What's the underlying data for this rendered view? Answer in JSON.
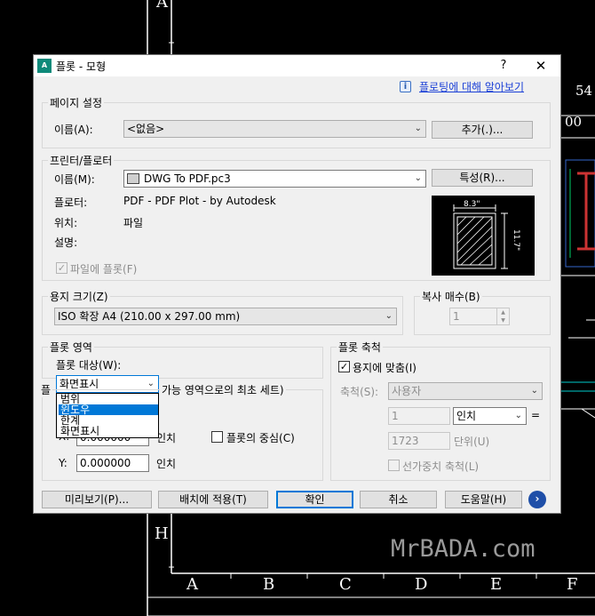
{
  "window": {
    "title": "플롯 - 모형",
    "help_button": "?",
    "close_button": "✕",
    "help_link": "플로팅에 대해 알아보기"
  },
  "page_setup": {
    "legend": "페이지 설정",
    "name_label": "이름(A):",
    "name_value": "<없음>",
    "add_button": "추가(.)..."
  },
  "printer": {
    "legend": "프린터/플로터",
    "name_label": "이름(M):",
    "name_value": "DWG To PDF.pc3",
    "properties_button": "특성(R)...",
    "plotter_label": "플로터:",
    "plotter_value": "PDF - PDF Plot - by Autodesk",
    "location_label": "위치:",
    "location_value": "파일",
    "description_label": "설명:",
    "plot_to_file_label": "파일에 플롯(F)",
    "plot_to_file_checked": true,
    "preview_width": "8.3\"",
    "preview_height": "11.7\""
  },
  "paper_size": {
    "legend": "용지 크기(Z)",
    "value": "ISO 확장 A4 (210.00 x 297.00 mm)"
  },
  "copies": {
    "legend": "복사 매수(B)",
    "value": "1"
  },
  "plot_area": {
    "legend": "플롯 영역",
    "what_to_plot_label": "플롯 대상(W):",
    "what_to_plot_value": "화면표시",
    "options": [
      "범위",
      "윈도우",
      "한계",
      "화면표시"
    ],
    "selected_index": 1
  },
  "plot_offset": {
    "legend_partial": "가능 영역으로의 최초 세트)",
    "legend_prefix": "플",
    "x_label": "X:",
    "x_value": "0.000000",
    "x_unit": "인치",
    "y_label": "Y:",
    "y_value": "0.000000",
    "y_unit": "인치",
    "center_label": "플롯의 중심(C)"
  },
  "plot_scale": {
    "legend": "플롯 축척",
    "fit_label": "용지에 맞춤(I)",
    "fit_checked": true,
    "scale_label": "축척(S):",
    "scale_value": "사용자",
    "value1": "1",
    "unit_value": "인치",
    "equals": "=",
    "value2": "1723",
    "unit2_label": "단위(U)",
    "lineweight_label": "선가중치 축척(L)"
  },
  "footer": {
    "preview_button": "미리보기(P)...",
    "apply_button": "배치에 적용(T)",
    "ok_button": "확인",
    "cancel_button": "취소",
    "help_button": "도움말(H)",
    "more_button": "›"
  },
  "cad": {
    "watermark": "MrBADA.com",
    "column_labels": [
      "A",
      "B",
      "C",
      "D",
      "E",
      "F"
    ],
    "row_label_top": "A",
    "row_label_h": "H",
    "dim_text": "54",
    "dim_text2": "00"
  }
}
